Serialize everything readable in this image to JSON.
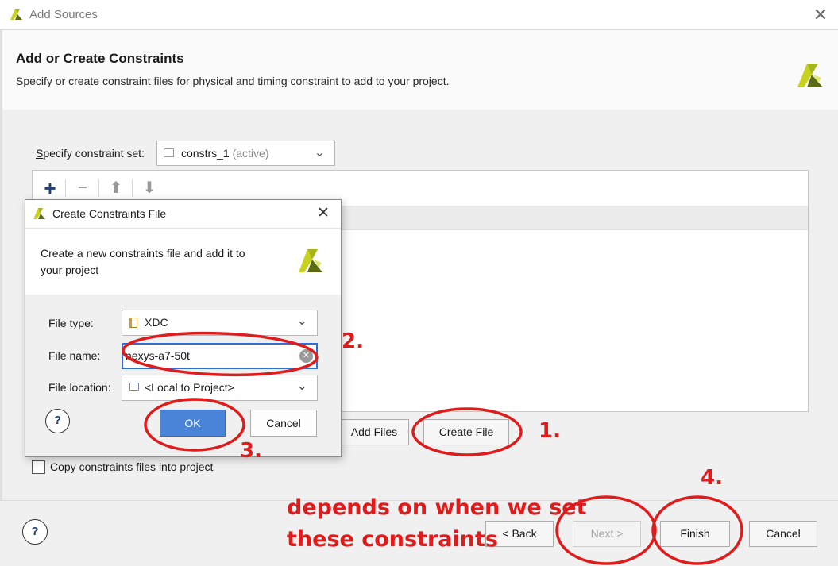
{
  "window": {
    "title": "Add Sources",
    "close_glyph": "✕",
    "icon": "vivado-logo-icon"
  },
  "page": {
    "heading": "Add or Create Constraints",
    "description": "Specify or create constraint files for physical and timing constraint to add to your project."
  },
  "constraint_set": {
    "label": "Specify constraint set:",
    "value": "constrs_1",
    "value_suffix": "(active)"
  },
  "toolbar": {
    "add_glyph": "+",
    "remove_glyph": "−",
    "up_glyph": "⬆",
    "down_glyph": "⬇"
  },
  "buttons": {
    "add_files": "Add Files",
    "create_file": "Create File",
    "back": "< Back",
    "next": "Next >",
    "finish": "Finish",
    "cancel": "Cancel",
    "help": "?"
  },
  "copy_option": {
    "label": "Copy constraints files into project",
    "checked": false
  },
  "dialog": {
    "title": "Create Constraints File",
    "close_glyph": "✕",
    "desc_line1": "Create a new constraints file and add it to",
    "desc_line2": "your project",
    "file_type": {
      "label": "File type:",
      "value": "XDC"
    },
    "file_name": {
      "label": "File name:",
      "value": "nexys-a7-50t"
    },
    "file_location": {
      "label": "File location:",
      "value": "<Local to Project>"
    },
    "ok": "OK",
    "cancel": "Cancel",
    "help": "?"
  },
  "annotations": {
    "step1": "1.",
    "step2": "2.",
    "step3": "3.",
    "step4": "4.",
    "note_line1": "depends on when we set",
    "note_line2": "these constraints",
    "color": "#e01b1b"
  },
  "colors": {
    "logo_yellow": "#c8d21e",
    "logo_dark": "#5a6b12",
    "ok_blue": "#4a84d8",
    "focus_blue": "#2f6fd6"
  }
}
